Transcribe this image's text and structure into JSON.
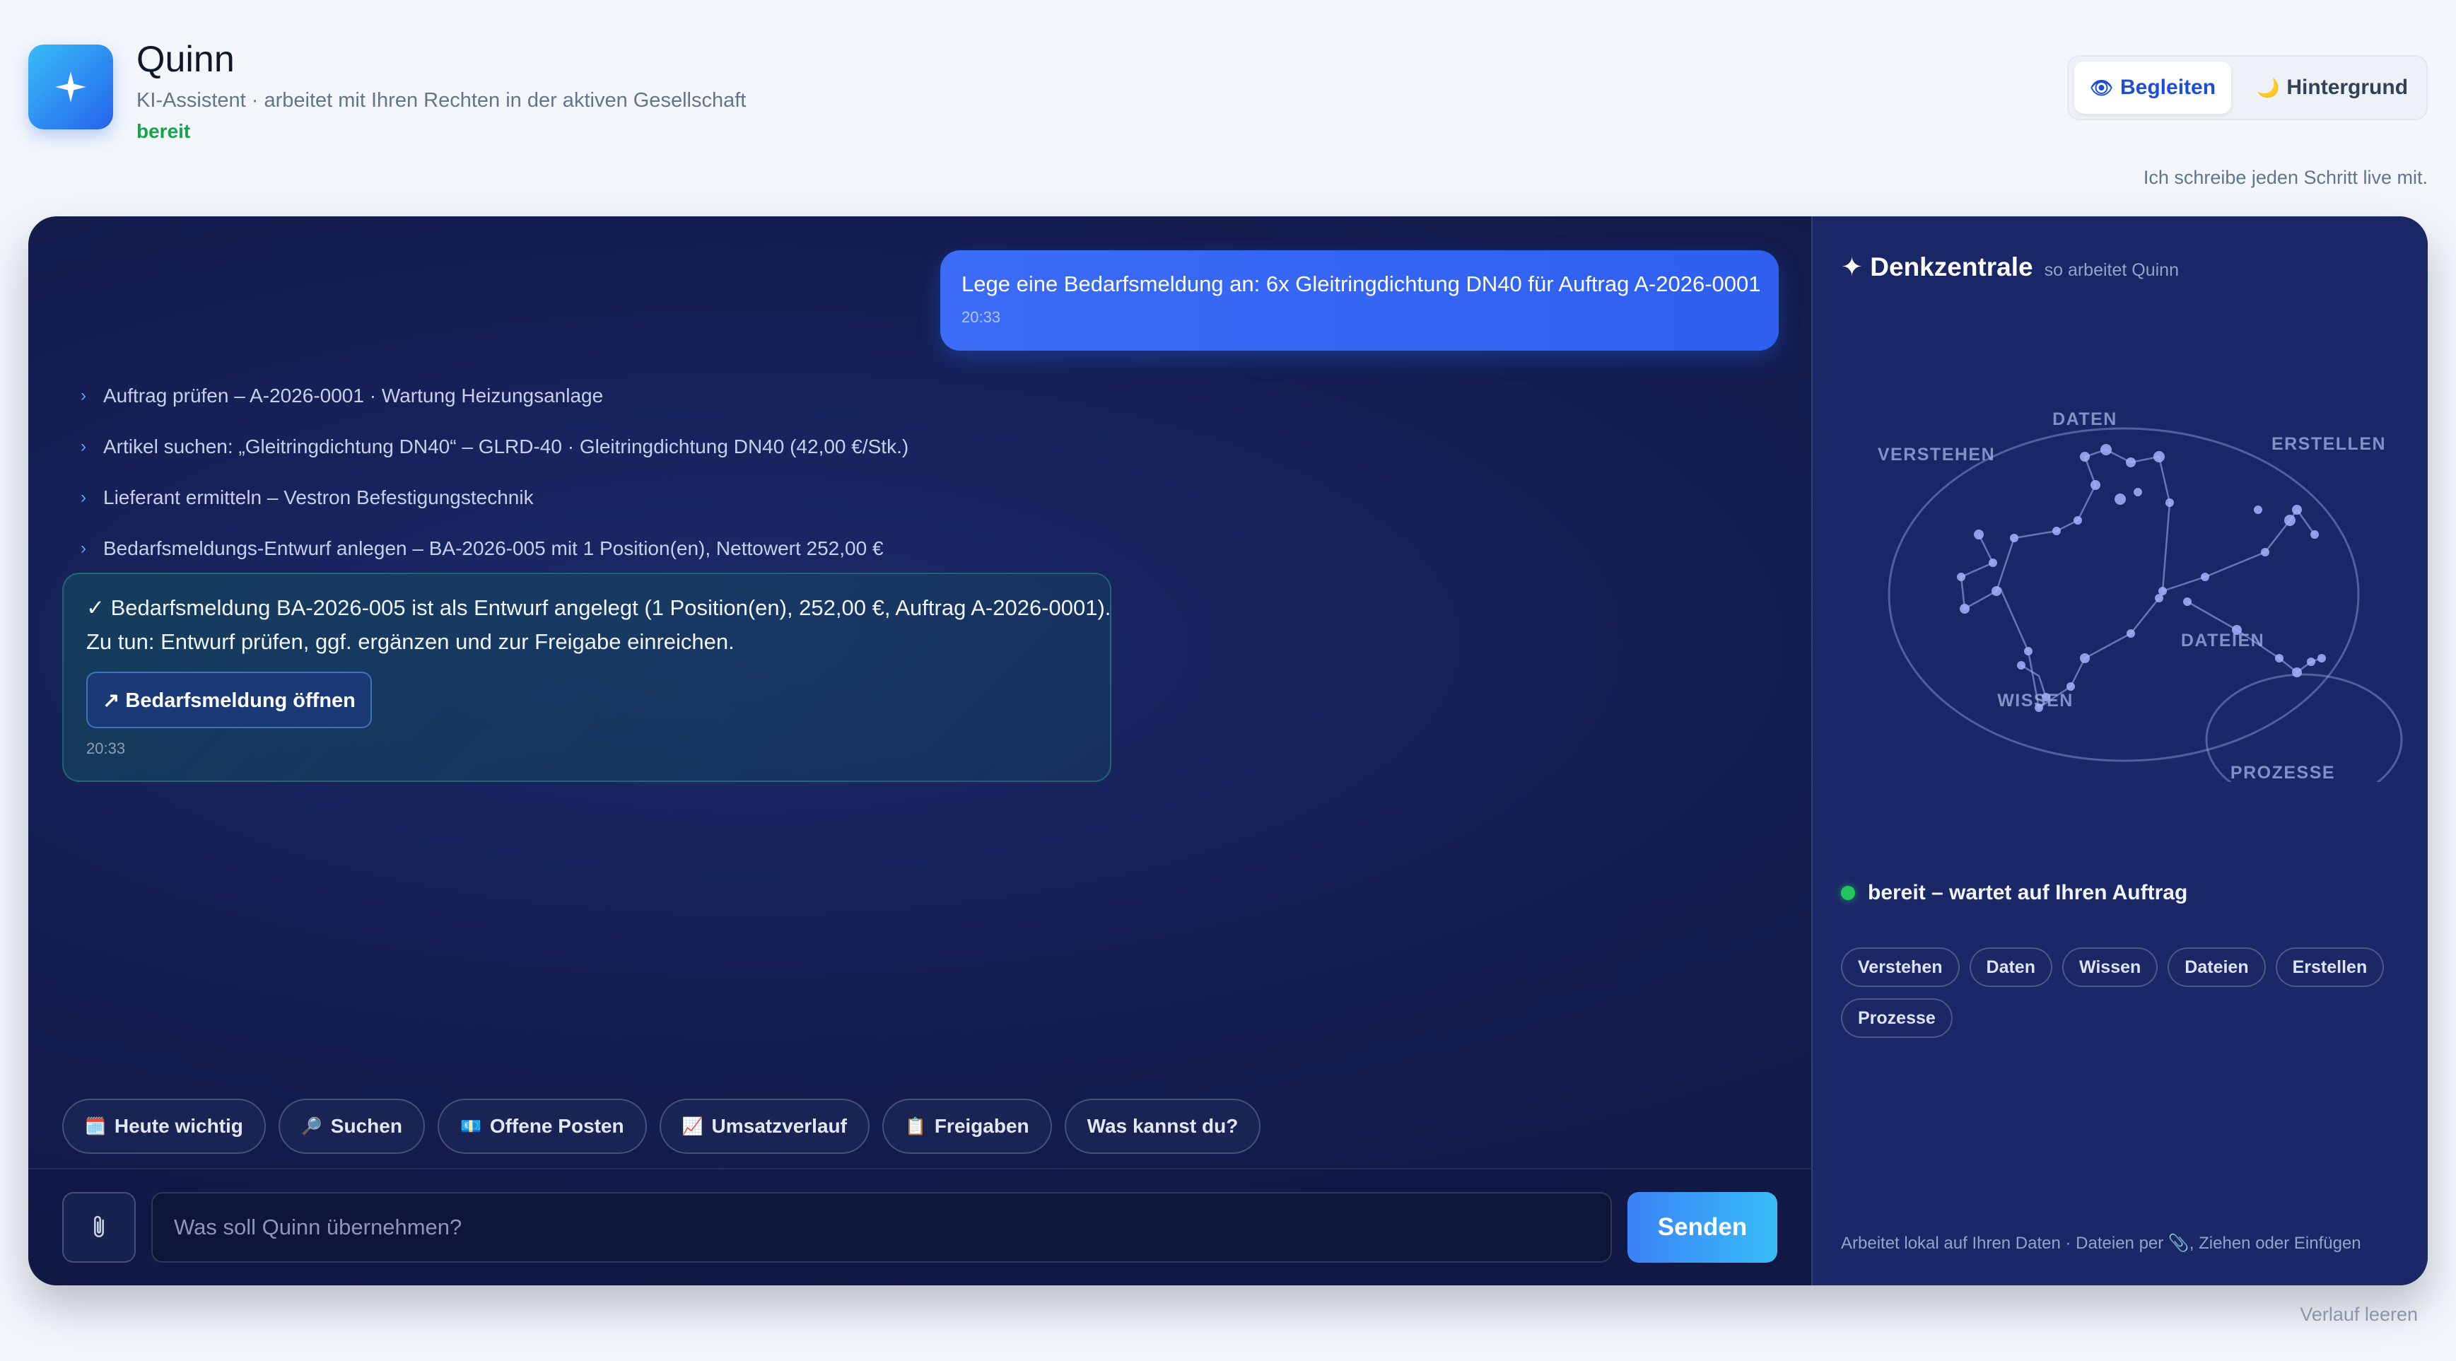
{
  "header": {
    "title": "Quinn",
    "subtitle": "KI-Assistent · arbeitet mit Ihren Rechten in der aktiven Gesellschaft",
    "status": "bereit",
    "modes": [
      {
        "label": "Begleiten",
        "icon": "eye-icon",
        "active": true
      },
      {
        "label": "Hintergrund",
        "icon": "moon-icon",
        "active": false
      }
    ],
    "live_note": "Ich schreibe jeden Schritt live mit."
  },
  "chat": {
    "user_message": {
      "text": "Lege eine Bedarfsmeldung an: 6x Gleitringdichtung DN40 für Auftrag A-2026-0001",
      "time": "20:33"
    },
    "steps": [
      "Auftrag prüfen – A-2026-0001 · Wartung Heizungsanlage",
      "Artikel suchen: „Gleitringdichtung DN40“ – GLRD-40 · Gleitringdichtung DN40 (42,00 €/Stk.)",
      "Lieferant ermitteln – Vestron Befestigungstechnik",
      "Bedarfsmeldungs-Entwurf anlegen – BA-2026-005 mit 1 Position(en), Nettowert 252,00 €"
    ],
    "result": {
      "line1": "✓ Bedarfsmeldung BA-2026-005 ist als Entwurf angelegt (1 Position(en), 252,00 €, Auftrag A-2026-0001).",
      "line2": "Zu tun: Entwurf prüfen, ggf. ergänzen und zur Freigabe einreichen.",
      "button_label": "↗ Bedarfsmeldung öffnen",
      "time": "20:33"
    },
    "quick_actions": [
      {
        "label": "Heute wichtig",
        "icon": "🗓️"
      },
      {
        "label": "Suchen",
        "icon": "🔎"
      },
      {
        "label": "Offene Posten",
        "icon": "💶"
      },
      {
        "label": "Umsatzverlauf",
        "icon": "📈"
      },
      {
        "label": "Freigaben",
        "icon": "📋"
      },
      {
        "label": "Was kannst du?",
        "icon": ""
      }
    ],
    "composer": {
      "placeholder": "Was soll Quinn übernehmen?",
      "send_label": "Senden"
    }
  },
  "side": {
    "title": "✦ Denkzentrale",
    "subtitle": "so arbeitet Quinn",
    "constellation_labels": [
      "DATEN",
      "VERSTEHEN",
      "ERSTELLEN",
      "DATEIEN",
      "WISSEN",
      "PROZESSE"
    ],
    "status": "bereit – wartet auf Ihren Auftrag",
    "tags": [
      "Verstehen",
      "Daten",
      "Wissen",
      "Dateien",
      "Erstellen",
      "Prozesse"
    ],
    "footer": "Arbeitet lokal auf Ihren Daten · Dateien per 📎, Ziehen oder Einfügen"
  },
  "footer": {
    "clear_history": "Verlauf leeren"
  },
  "colors": {
    "accent": "#2563eb",
    "status_green": "#16a34a",
    "panel_bg": "#141d50"
  }
}
